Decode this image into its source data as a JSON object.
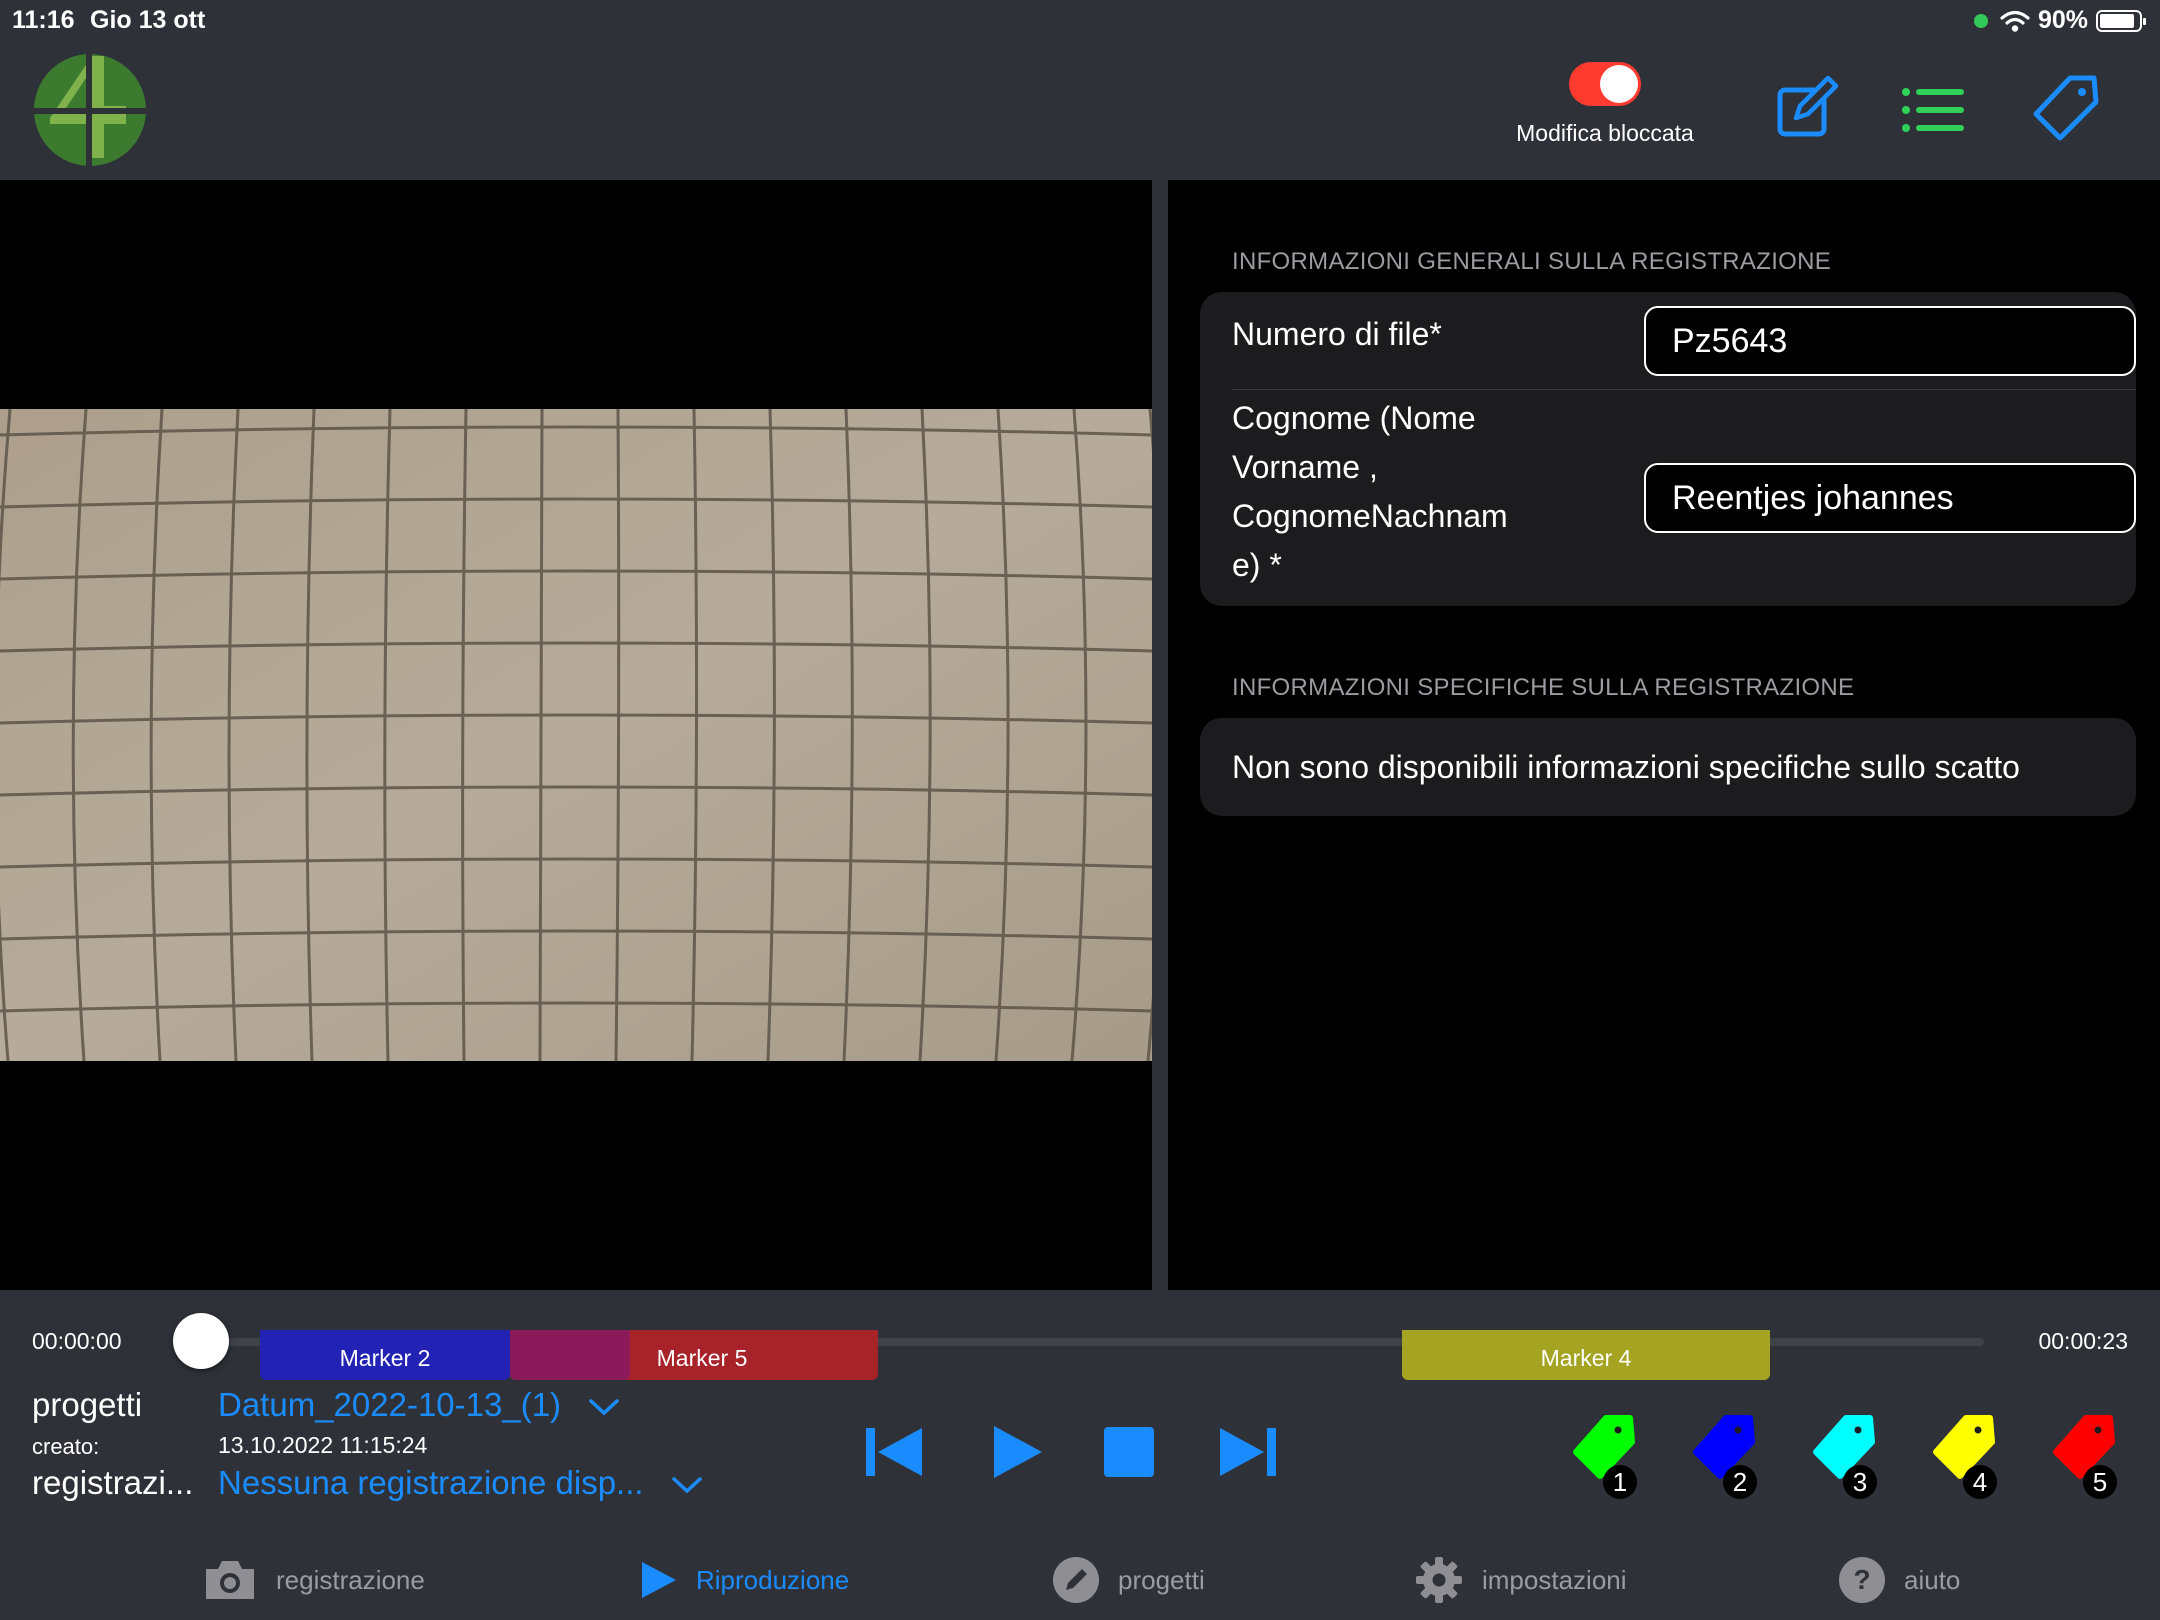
{
  "status_bar": {
    "time": "11:16",
    "date": "Gio 13 ott",
    "battery": "90%"
  },
  "header": {
    "lock_toggle_label": "Modifica bloccata",
    "lock_toggle_on": true,
    "icons": [
      "edit-icon",
      "list-icon",
      "tag-icon"
    ]
  },
  "info": {
    "general_section_title": "INFORMAZIONI GENERALI SULLA REGISTRAZIONE",
    "file_number_label": "Numero di file*",
    "file_number_value": "Pz5643",
    "surname_label_lines": [
      "Cognome (Nome",
      "Vorname ,",
      "CognomeNachnam",
      "e) *"
    ],
    "surname_value": "Reentjes johannes",
    "specific_section_title": "INFORMAZIONI SPECIFICHE SULLA REGISTRAZIONE",
    "specific_message": "Non sono disponibili informazioni specifiche sullo scatto"
  },
  "timeline": {
    "start_time": "00:00:00",
    "end_time": "00:00:23",
    "markers": [
      {
        "label": "Marker 2",
        "color": "#2222b4"
      },
      {
        "label": "Marker 5",
        "color": "#a8222a"
      },
      {
        "label": "Marker 4",
        "color": "#a4a322"
      }
    ],
    "overlap_color": "#8a1a5a"
  },
  "meta": {
    "projects_label": "progetti",
    "project_value": "Datum_2022-10-13_(1)",
    "created_label": "creato:",
    "created_value": "13.10.2022 11:15:24",
    "recordings_label": "registrazi...",
    "recordings_value": "Nessuna registrazione disp..."
  },
  "transport": [
    "skip-back-icon",
    "play-icon",
    "stop-icon",
    "skip-forward-icon"
  ],
  "marker_tags": [
    {
      "number": "1",
      "color": "#00ff00"
    },
    {
      "number": "2",
      "color": "#0000ff"
    },
    {
      "number": "3",
      "color": "#00ffff"
    },
    {
      "number": "4",
      "color": "#ffff00"
    },
    {
      "number": "5",
      "color": "#ff0000"
    }
  ],
  "tabs": [
    {
      "label": "registrazione",
      "icon": "camera-icon",
      "active": false
    },
    {
      "label": "Riproduzione",
      "icon": "play-icon",
      "active": true
    },
    {
      "label": "progetti",
      "icon": "pencil-icon",
      "active": false
    },
    {
      "label": "impostazioni",
      "icon": "gear-icon",
      "active": false
    },
    {
      "label": "aiuto",
      "icon": "help-icon",
      "active": false
    }
  ],
  "colors": {
    "accent_blue": "#1a8cff",
    "toggle_red": "#ff3b30",
    "list_green": "#30d158",
    "chrome": "#2e3238",
    "card": "#1c1c1e"
  }
}
